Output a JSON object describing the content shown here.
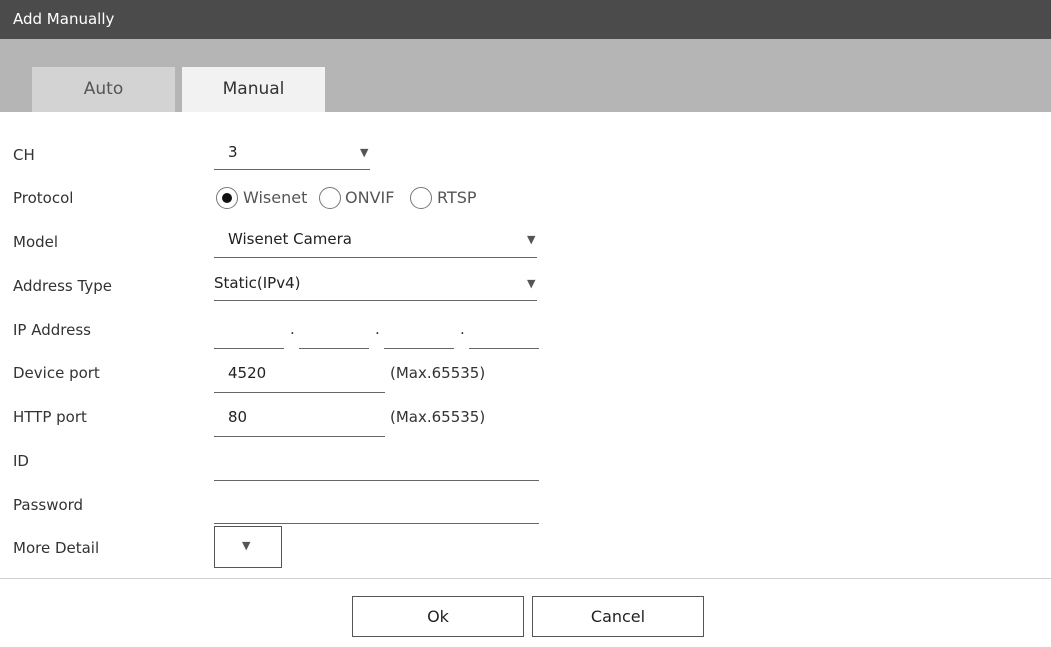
{
  "window": {
    "title": "Add Manually"
  },
  "tabs": [
    {
      "label": "Auto",
      "active": false
    },
    {
      "label": "Manual",
      "active": true
    }
  ],
  "form": {
    "ch": {
      "label": "CH",
      "value": "3"
    },
    "protocol": {
      "label": "Protocol",
      "options": [
        "Wisenet",
        "ONVIF",
        "RTSP"
      ],
      "selected": "Wisenet"
    },
    "model": {
      "label": "Model",
      "value": "Wisenet Camera"
    },
    "address_type": {
      "label": "Address Type",
      "value": "Static(IPv4)"
    },
    "ip_address": {
      "label": "IP Address",
      "octets": [
        "",
        "",
        "",
        ""
      ],
      "separator": "."
    },
    "device_port": {
      "label": "Device port",
      "value": "4520",
      "hint": "(Max.65535)"
    },
    "http_port": {
      "label": "HTTP port",
      "value": "80",
      "hint": "(Max.65535)"
    },
    "id": {
      "label": "ID",
      "value": ""
    },
    "password": {
      "label": "Password",
      "value": ""
    },
    "more_detail": {
      "label": "More Detail",
      "icon": "caret-down-icon"
    }
  },
  "buttons": {
    "ok": "Ok",
    "cancel": "Cancel"
  },
  "colors": {
    "titlebar": "#4b4b4b",
    "tabbar": "#b5b5b5",
    "active_tab": "#f2f2f2"
  }
}
